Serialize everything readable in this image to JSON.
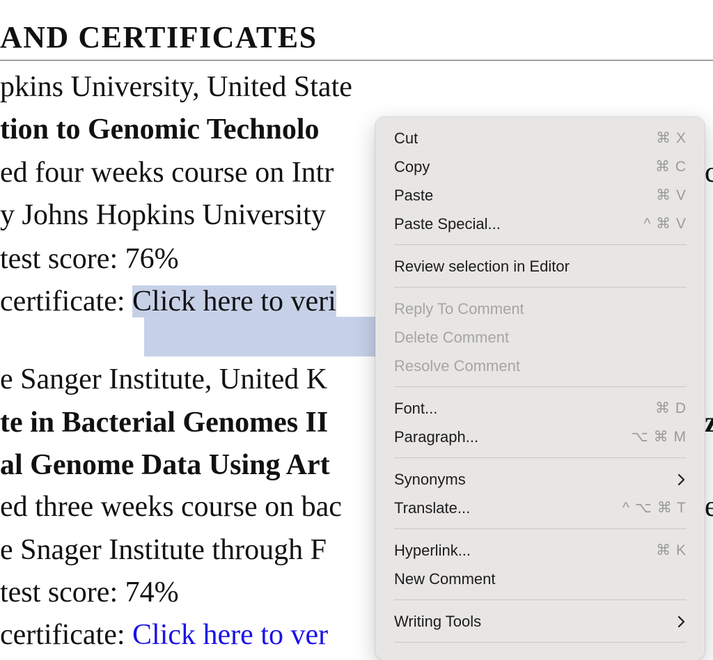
{
  "document": {
    "heading": "AND CERTIFICATES",
    "lines": [
      "pkins University, United State",
      "tion to Genomic Technolo",
      "ed four weeks course on Intr",
      "y Johns Hopkins University",
      "test score: 76%",
      "certificate: ",
      "Click here to veri",
      "e Sanger Institute, United K",
      "te in Bacterial Genomes II",
      "al Genome Data Using Art",
      "ed three weeks course on bac",
      "e Snager Institute through F",
      "test score: 74%",
      "certificate: ",
      "Click here to ver"
    ],
    "peek_chars": [
      "c",
      "z",
      "e"
    ],
    "colors": {
      "selection": "#c6d1e8",
      "link": "#1a12e8"
    }
  },
  "context_menu": {
    "items": [
      {
        "label": "Cut",
        "shortcut": "⌘ X"
      },
      {
        "label": "Copy",
        "shortcut": "⌘ C"
      },
      {
        "label": "Paste",
        "shortcut": "⌘ V"
      },
      {
        "label": "Paste Special...",
        "shortcut": "^ ⌘ V"
      },
      {
        "label": "Review selection in Editor",
        "shortcut": ""
      },
      {
        "label": "Reply To Comment",
        "shortcut": ""
      },
      {
        "label": "Delete Comment",
        "shortcut": ""
      },
      {
        "label": "Resolve Comment",
        "shortcut": ""
      },
      {
        "label": "Font...",
        "shortcut": "⌘ D"
      },
      {
        "label": "Paragraph...",
        "shortcut": "⌥ ⌘ M"
      },
      {
        "label": "Synonyms",
        "shortcut": ""
      },
      {
        "label": "Translate...",
        "shortcut": "^ ⌥ ⌘ T"
      },
      {
        "label": "Hyperlink...",
        "shortcut": "⌘ K"
      },
      {
        "label": "New Comment",
        "shortcut": ""
      },
      {
        "label": "Writing Tools",
        "shortcut": ""
      }
    ]
  }
}
